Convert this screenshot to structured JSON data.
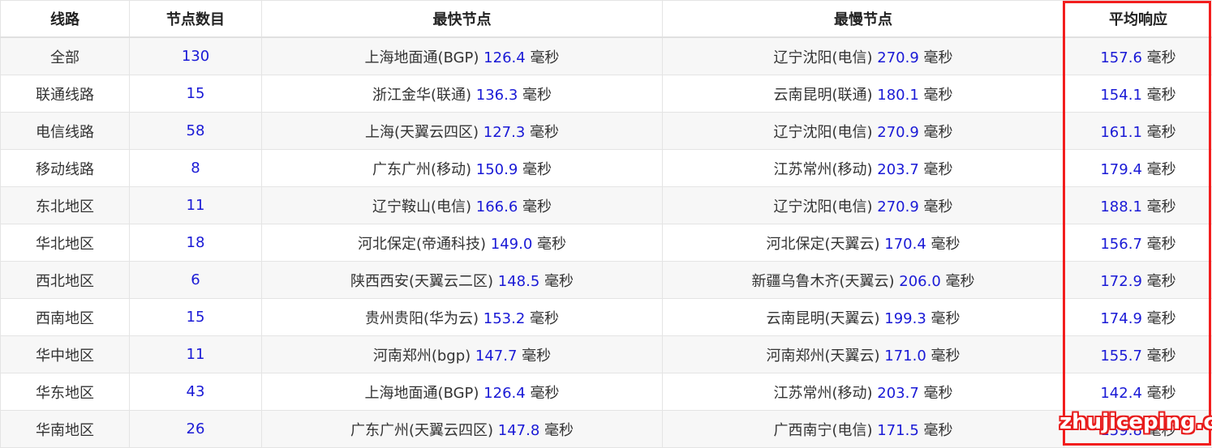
{
  "table": {
    "headers": [
      "线路",
      "节点数目",
      "最快节点",
      "最慢节点",
      "平均响应"
    ],
    "unit": "毫秒",
    "rows": [
      {
        "line": "全部",
        "count": "130",
        "fast_name": "上海地面通(BGP)",
        "fast_ms": "126.4",
        "slow_name": "辽宁沈阳(电信)",
        "slow_ms": "270.9",
        "avg_ms": "157.6"
      },
      {
        "line": "联通线路",
        "count": "15",
        "fast_name": "浙江金华(联通)",
        "fast_ms": "136.3",
        "slow_name": "云南昆明(联通)",
        "slow_ms": "180.1",
        "avg_ms": "154.1"
      },
      {
        "line": "电信线路",
        "count": "58",
        "fast_name": "上海(天翼云四区)",
        "fast_ms": "127.3",
        "slow_name": "辽宁沈阳(电信)",
        "slow_ms": "270.9",
        "avg_ms": "161.1"
      },
      {
        "line": "移动线路",
        "count": "8",
        "fast_name": "广东广州(移动)",
        "fast_ms": "150.9",
        "slow_name": "江苏常州(移动)",
        "slow_ms": "203.7",
        "avg_ms": "179.4"
      },
      {
        "line": "东北地区",
        "count": "11",
        "fast_name": "辽宁鞍山(电信)",
        "fast_ms": "166.6",
        "slow_name": "辽宁沈阳(电信)",
        "slow_ms": "270.9",
        "avg_ms": "188.1"
      },
      {
        "line": "华北地区",
        "count": "18",
        "fast_name": "河北保定(帝通科技)",
        "fast_ms": "149.0",
        "slow_name": "河北保定(天翼云)",
        "slow_ms": "170.4",
        "avg_ms": "156.7"
      },
      {
        "line": "西北地区",
        "count": "6",
        "fast_name": "陕西西安(天翼云二区)",
        "fast_ms": "148.5",
        "slow_name": "新疆乌鲁木齐(天翼云)",
        "slow_ms": "206.0",
        "avg_ms": "172.9"
      },
      {
        "line": "西南地区",
        "count": "15",
        "fast_name": "贵州贵阳(华为云)",
        "fast_ms": "153.2",
        "slow_name": "云南昆明(天翼云)",
        "slow_ms": "199.3",
        "avg_ms": "174.9"
      },
      {
        "line": "华中地区",
        "count": "11",
        "fast_name": "河南郑州(bgp)",
        "fast_ms": "147.7",
        "slow_name": "河南郑州(天翼云)",
        "slow_ms": "171.0",
        "avg_ms": "155.7"
      },
      {
        "line": "华东地区",
        "count": "43",
        "fast_name": "上海地面通(BGP)",
        "fast_ms": "126.4",
        "slow_name": "江苏常州(移动)",
        "slow_ms": "203.7",
        "avg_ms": "142.4"
      },
      {
        "line": "华南地区",
        "count": "26",
        "fast_name": "广东广州(天翼云四区)",
        "fast_ms": "147.8",
        "slow_name": "广西南宁(电信)",
        "slow_ms": "171.5",
        "avg_ms": "159.8"
      }
    ]
  },
  "watermark": "zhujiceping.com",
  "colors": {
    "number": "#1a1ad6",
    "highlight_box": "#f21d1d",
    "stripe": "#f7f7f7"
  }
}
